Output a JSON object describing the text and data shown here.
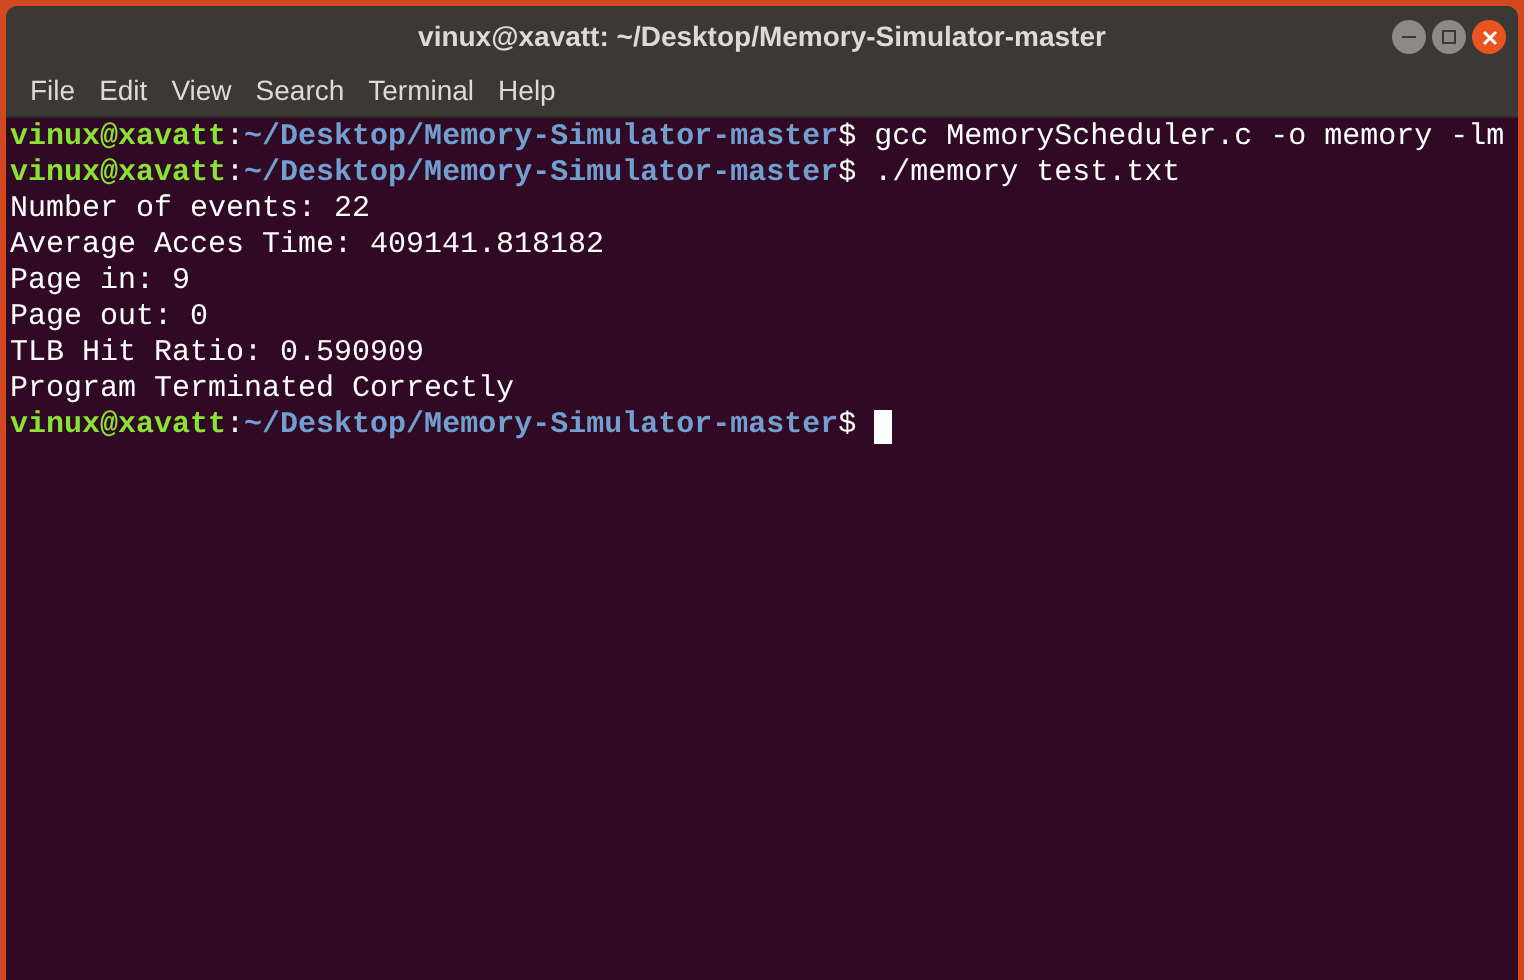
{
  "window": {
    "title": "vinux@xavatt: ~/Desktop/Memory-Simulator-master"
  },
  "menu": [
    "File",
    "Edit",
    "View",
    "Search",
    "Terminal",
    "Help"
  ],
  "lines": [
    {
      "kind": "prompt",
      "user_host": "vinux@xavatt",
      "separator": ":",
      "path": "~/Desktop/Memory-Simulator-master",
      "symbol": "$",
      "command": "gcc MemoryScheduler.c -o memory -lm"
    },
    {
      "kind": "prompt",
      "user_host": "vinux@xavatt",
      "separator": ":",
      "path": "~/Desktop/Memory-Simulator-master",
      "symbol": "$",
      "command": "./memory test.txt"
    },
    {
      "kind": "output",
      "text": "Number of events: 22"
    },
    {
      "kind": "output",
      "text": "Average Acces Time: 409141.818182"
    },
    {
      "kind": "output",
      "text": "Page in: 9"
    },
    {
      "kind": "output",
      "text": "Page out: 0"
    },
    {
      "kind": "output",
      "text": "TLB Hit Ratio: 0.590909"
    },
    {
      "kind": "output",
      "text": "Program Terminated Correctly"
    },
    {
      "kind": "prompt",
      "user_host": "vinux@xavatt",
      "separator": ":",
      "path": "~/Desktop/Memory-Simulator-master",
      "symbol": "$",
      "cursor": true
    }
  ]
}
